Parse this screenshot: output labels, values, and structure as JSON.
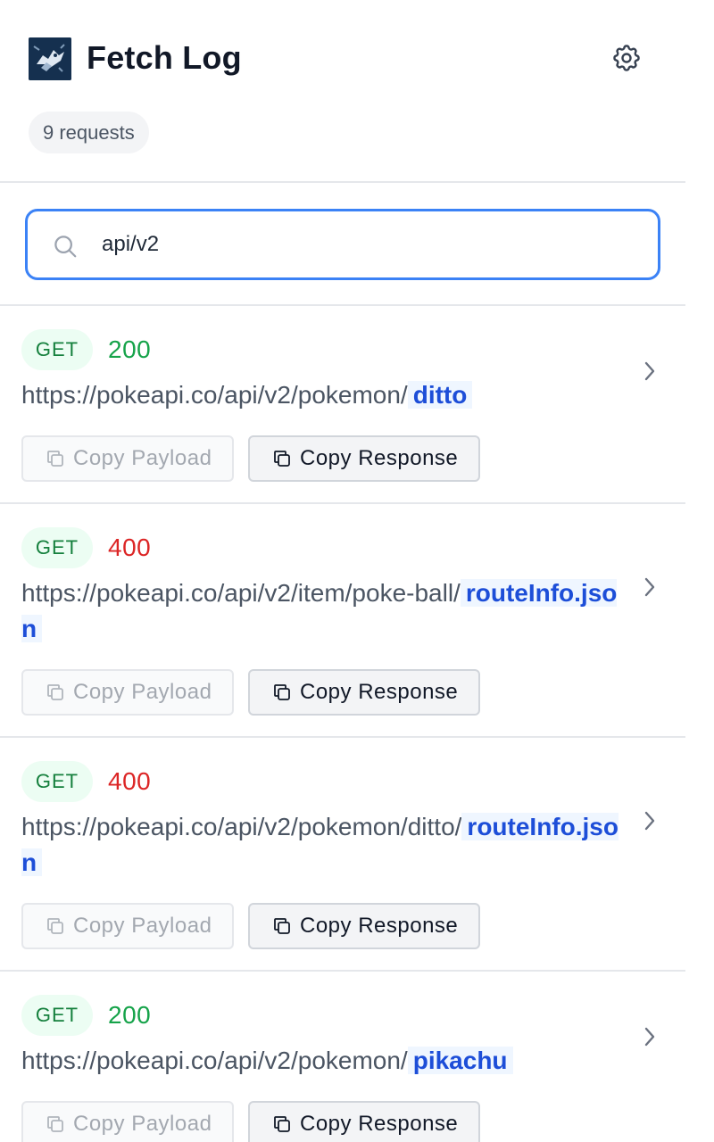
{
  "header": {
    "title": "Fetch Log",
    "request_count": "9 requests"
  },
  "search": {
    "value": "api/v2",
    "placeholder": ""
  },
  "entries": [
    {
      "method": "GET",
      "status": "200",
      "url_base": "https://pokeapi.co/api/v2/pokemon/",
      "url_highlight": "ditto",
      "copy_payload": "Copy Payload",
      "copy_response": "Copy Response"
    },
    {
      "method": "GET",
      "status": "400",
      "url_base": "https://pokeapi.co/api/v2/item/poke-ball/",
      "url_highlight": "routeInfo.json",
      "copy_payload": "Copy Payload",
      "copy_response": "Copy Response"
    },
    {
      "method": "GET",
      "status": "400",
      "url_base": "https://pokeapi.co/api/v2/pokemon/ditto/",
      "url_highlight": "routeInfo.json",
      "copy_payload": "Copy Payload",
      "copy_response": "Copy Response"
    },
    {
      "method": "GET",
      "status": "200",
      "url_base": "https://pokeapi.co/api/v2/pokemon/",
      "url_highlight": "pikachu",
      "copy_payload": "Copy Payload",
      "copy_response": "Copy Response"
    }
  ],
  "icons": {
    "settings": "gear-icon",
    "search": "search-icon",
    "expand": "chevron-right-icon",
    "copy": "copy-icon"
  },
  "colors": {
    "accent": "#3b82f6",
    "success": "#16a34a",
    "error": "#dc2626",
    "highlight_text": "#1d4ed8",
    "highlight_bg": "#eff6ff"
  }
}
